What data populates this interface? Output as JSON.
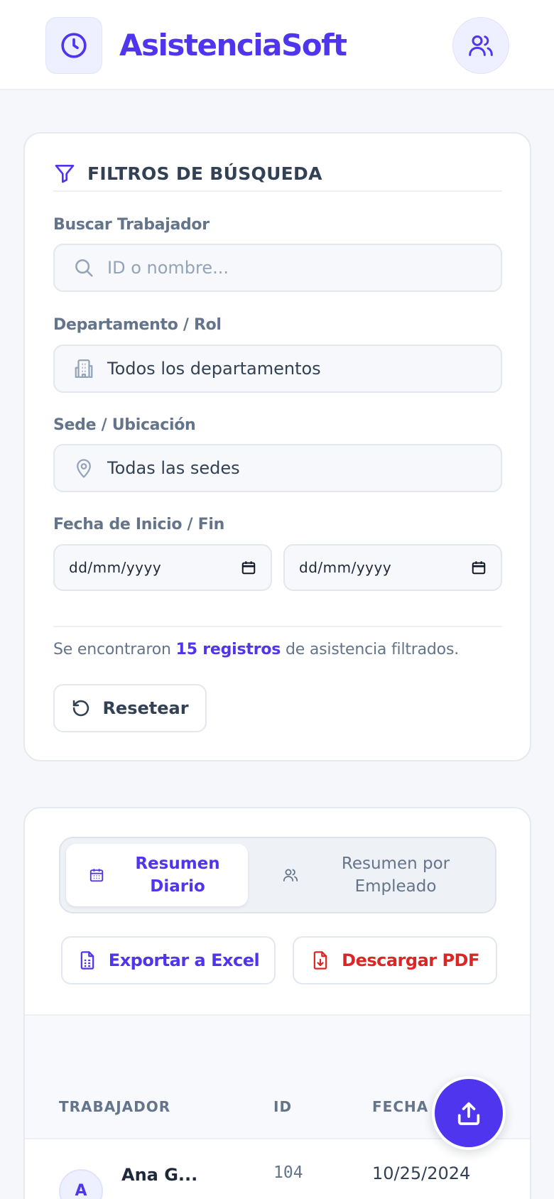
{
  "header": {
    "app_title": "AsistenciaSoft",
    "logo_icon": "clock-icon",
    "user_icon": "users-icon"
  },
  "filters": {
    "title": "FILTROS DE BÚSQUEDA",
    "search": {
      "label": "Buscar Trabajador",
      "placeholder": "ID o nombre..."
    },
    "department": {
      "label": "Departamento / Rol",
      "value": "Todos los departamentos"
    },
    "location": {
      "label": "Sede / Ubicación",
      "value": "Todas las sedes"
    },
    "dates": {
      "label": "Fecha de Inicio / Fin",
      "start": "dd/mm/yyyy",
      "end": "dd/mm/yyyy"
    },
    "result_prefix": "Se encontraron",
    "result_count": "15 registros",
    "result_suffix": "de asistencia filtrados.",
    "reset_label": "Resetear"
  },
  "results": {
    "tabs": [
      {
        "label": "Resumen Diario",
        "active": true
      },
      {
        "label": "Resumen por Empleado",
        "active": false
      }
    ],
    "export_excel": "Exportar a Excel",
    "download_pdf": "Descargar PDF",
    "columns": [
      "TRABAJADOR",
      "ID",
      "FECHA"
    ],
    "rows": [
      {
        "initial": "A",
        "name": "Ana G...",
        "id": "104",
        "date": "10/25/2024"
      }
    ]
  },
  "colors": {
    "accent": "#4f35ee",
    "danger": "#dc2626",
    "text_muted": "#64748b"
  }
}
